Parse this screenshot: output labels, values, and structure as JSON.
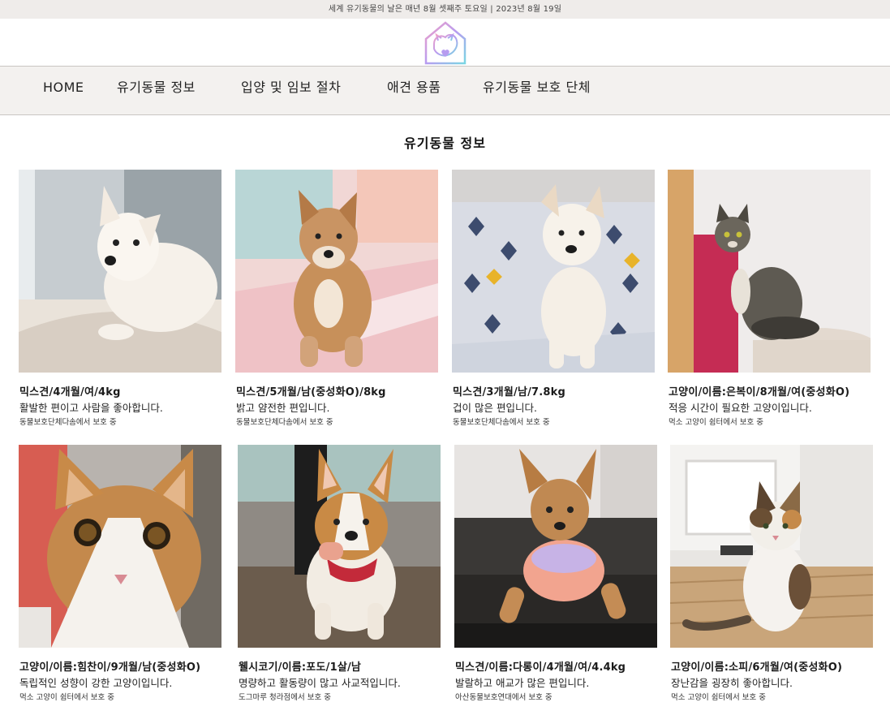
{
  "topbar": {
    "notice": "세계 유기동물의 날은 매년 8월 셋째주 토요일 | 2023년 8월 19일"
  },
  "logo": {
    "icon": "house-dog-cat-heart-logo-icon",
    "colors": [
      "#f2a0c6",
      "#b79cf0",
      "#7ad6e3"
    ]
  },
  "nav": {
    "items": [
      {
        "label": "HOME"
      },
      {
        "label": "유기동물 정보"
      },
      {
        "label": "입양 및 임보 절차"
      },
      {
        "label": "애견 용품"
      },
      {
        "label": "유기동물 보호 단체"
      }
    ]
  },
  "section": {
    "title": "유기동물 정보"
  },
  "animals": [
    {
      "title": "믹스견/4개월/여/4kg",
      "desc": "활발한 편이고 사람을 좋아합니다.",
      "shelter": "동물보호단체다솜에서 보호 중",
      "photo": "white-puppy-photo"
    },
    {
      "title": "믹스견/5개월/남(중성화O)/8kg",
      "desc": "밝고 얌전한 편입니다.",
      "shelter": "동물보호단체다솜에서 보호 중",
      "photo": "shiba-mix-puppy-photo"
    },
    {
      "title": "믹스견/3개월/남/7.8kg",
      "desc": "겁이 많은 편입니다.",
      "shelter": "동물보호단체다솜에서 보호 중",
      "photo": "white-puppy-on-blanket-photo"
    },
    {
      "title": "고양이/이름:은복이/8개월/여(중성화O)",
      "desc": "적응 시간이 필요한 고양이입니다.",
      "shelter": "먹소 고양이 쉼터에서 보호 중",
      "photo": "tabby-cat-photo"
    },
    {
      "title": "고양이/이름:힘찬이/9개월/남(중성화O)",
      "desc": "독립적인 성향이 강한 고양이입니다.",
      "shelter": "먹소 고양이 쉼터에서 보호 중",
      "photo": "orange-white-cat-photo"
    },
    {
      "title": "웰시코기/이름:포도/1살/남",
      "desc": "명량하고 활동량이 많고 사교적입니다.",
      "shelter": "도그마루 청라점에서 보호 중",
      "photo": "corgi-photo"
    },
    {
      "title": "믹스견/이름:다롱이/4개월/여/4.4kg",
      "desc": "발랄하고 애교가 많은 편입니다.",
      "shelter": "아산동물보호연대에서 보호 중",
      "photo": "brown-puppy-sweater-photo"
    },
    {
      "title": "고양이/이름:소피/6개월/여(중성화O)",
      "desc": "장난감을 굉장히 좋아합니다.",
      "shelter": "먹소 고양이 쉼터에서 보호 중",
      "photo": "calico-cat-photo"
    }
  ]
}
